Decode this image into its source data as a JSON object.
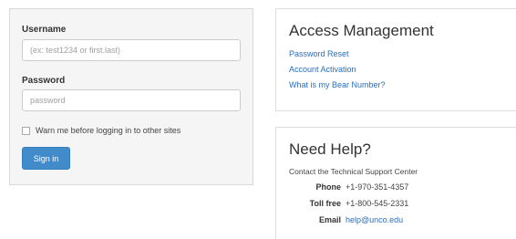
{
  "login": {
    "username_label": "Username",
    "username_placeholder": "(ex: test1234 or first.last)",
    "username_value": "",
    "password_label": "Password",
    "password_placeholder": "password",
    "password_value": "",
    "warn_label": "Warn me before logging in to other sites",
    "warn_checked": false,
    "sign_in_label": "Sign in"
  },
  "access": {
    "title": "Access Management",
    "links": [
      "Password Reset",
      "Account Activation",
      "What is my Bear Number?"
    ]
  },
  "help": {
    "title": "Need Help?",
    "intro": "Contact the Technical Support Center",
    "phone_label": "Phone",
    "phone_value": "+1-970-351-4357",
    "tollfree_label": "Toll free",
    "tollfree_value": "+1-800-545-2331",
    "email_label": "Email",
    "email_value": "help@unco.edu"
  },
  "colors": {
    "primary_button": "#428bca",
    "link": "#2a6ebb",
    "panel_bg": "#f5f5f5"
  }
}
